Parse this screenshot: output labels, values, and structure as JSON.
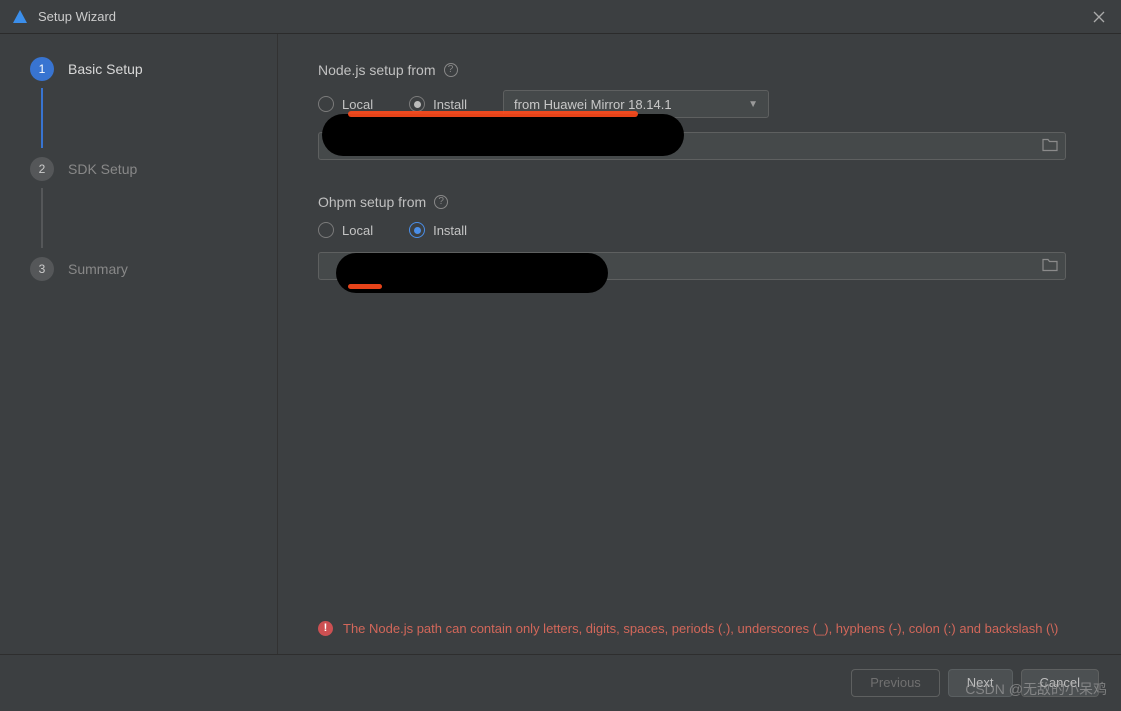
{
  "window": {
    "title": "Setup Wizard"
  },
  "sidebar": {
    "steps": [
      {
        "num": "1",
        "label": "Basic Setup"
      },
      {
        "num": "2",
        "label": "SDK Setup"
      },
      {
        "num": "3",
        "label": "Summary"
      }
    ]
  },
  "main": {
    "node": {
      "label": "Node.js setup from",
      "local": "Local",
      "install": "Install",
      "dropdown": "from Huawei Mirror 18.14.1"
    },
    "ohpm": {
      "label": "Ohpm setup from",
      "local": "Local",
      "install": "Install"
    },
    "error": "The Node.js path can contain only letters, digits, spaces, periods (.), underscores (_), hyphens (-), colon (:) and backslash (\\)"
  },
  "footer": {
    "previous": "Previous",
    "next": "Next",
    "cancel": "Cancel"
  },
  "watermark": "CSDN @无敌的小呆鸡"
}
